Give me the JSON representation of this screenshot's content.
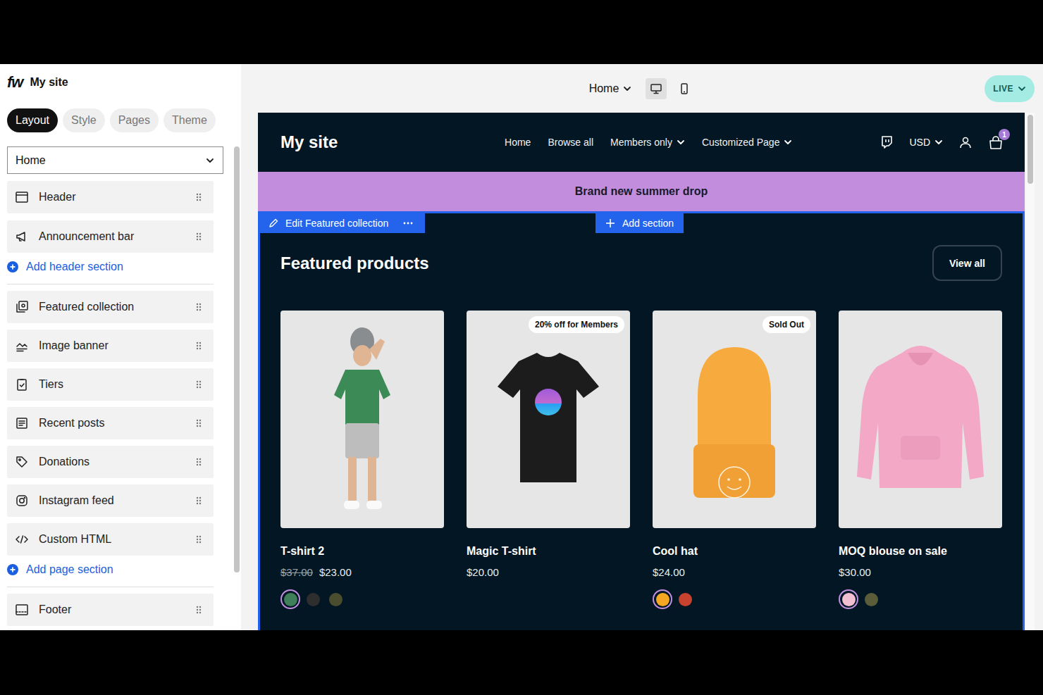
{
  "app": {
    "logo": "fw",
    "site_name": "My site"
  },
  "tabs": [
    {
      "label": "Layout",
      "selected": true
    },
    {
      "label": "Style",
      "selected": false
    },
    {
      "label": "Pages",
      "selected": false
    },
    {
      "label": "Theme",
      "selected": false
    }
  ],
  "page_select": {
    "value": "Home"
  },
  "header_sections": [
    {
      "label": "Header"
    },
    {
      "label": "Announcement bar"
    }
  ],
  "add_header_section": "Add header section",
  "page_sections": [
    {
      "label": "Featured collection"
    },
    {
      "label": "Image banner"
    },
    {
      "label": "Tiers"
    },
    {
      "label": "Recent posts"
    },
    {
      "label": "Donations"
    },
    {
      "label": "Instagram feed"
    },
    {
      "label": "Custom HTML"
    }
  ],
  "add_page_section": "Add page section",
  "footer_sections": [
    {
      "label": "Footer"
    }
  ],
  "toolbar": {
    "page": "Home",
    "devices": [
      {
        "kind": "desktop",
        "selected": true
      },
      {
        "kind": "mobile",
        "selected": false
      }
    ],
    "status": "LIVE"
  },
  "preview": {
    "nav": {
      "brand": "My site",
      "links": [
        {
          "label": "Home",
          "dropdown": false
        },
        {
          "label": "Browse all",
          "dropdown": false
        },
        {
          "label": "Members only",
          "dropdown": true
        },
        {
          "label": "Customized Page",
          "dropdown": true
        }
      ],
      "currency": "USD",
      "cart_count": "1"
    },
    "announcement": "Brand new summer drop",
    "edit_label": "Edit Featured collection",
    "add_section": "Add section",
    "featured": {
      "title": "Featured products",
      "view_all": "View all",
      "products": [
        {
          "name": "T-shirt 2",
          "old_price": "$37.00",
          "price": "$23.00",
          "swatches": [
            {
              "color": "#3f7f5a",
              "selected": true
            },
            {
              "color": "#2e2e2e",
              "selected": false
            },
            {
              "color": "#4b4d2f",
              "selected": false
            }
          ]
        },
        {
          "name": "Magic T-shirt",
          "price": "$20.00",
          "badge": "20% off for Members",
          "swatches": []
        },
        {
          "name": "Cool hat",
          "price": "$24.00",
          "badge": "Sold Out",
          "swatches": [
            {
              "color": "#f5a623",
              "selected": true
            },
            {
              "color": "#c8432f",
              "selected": false
            }
          ]
        },
        {
          "name": "MOQ blouse on sale",
          "price": "$30.00",
          "swatches": [
            {
              "color": "#f2bfd2",
              "selected": true
            },
            {
              "color": "#5b5c3a",
              "selected": false
            }
          ]
        }
      ]
    }
  }
}
